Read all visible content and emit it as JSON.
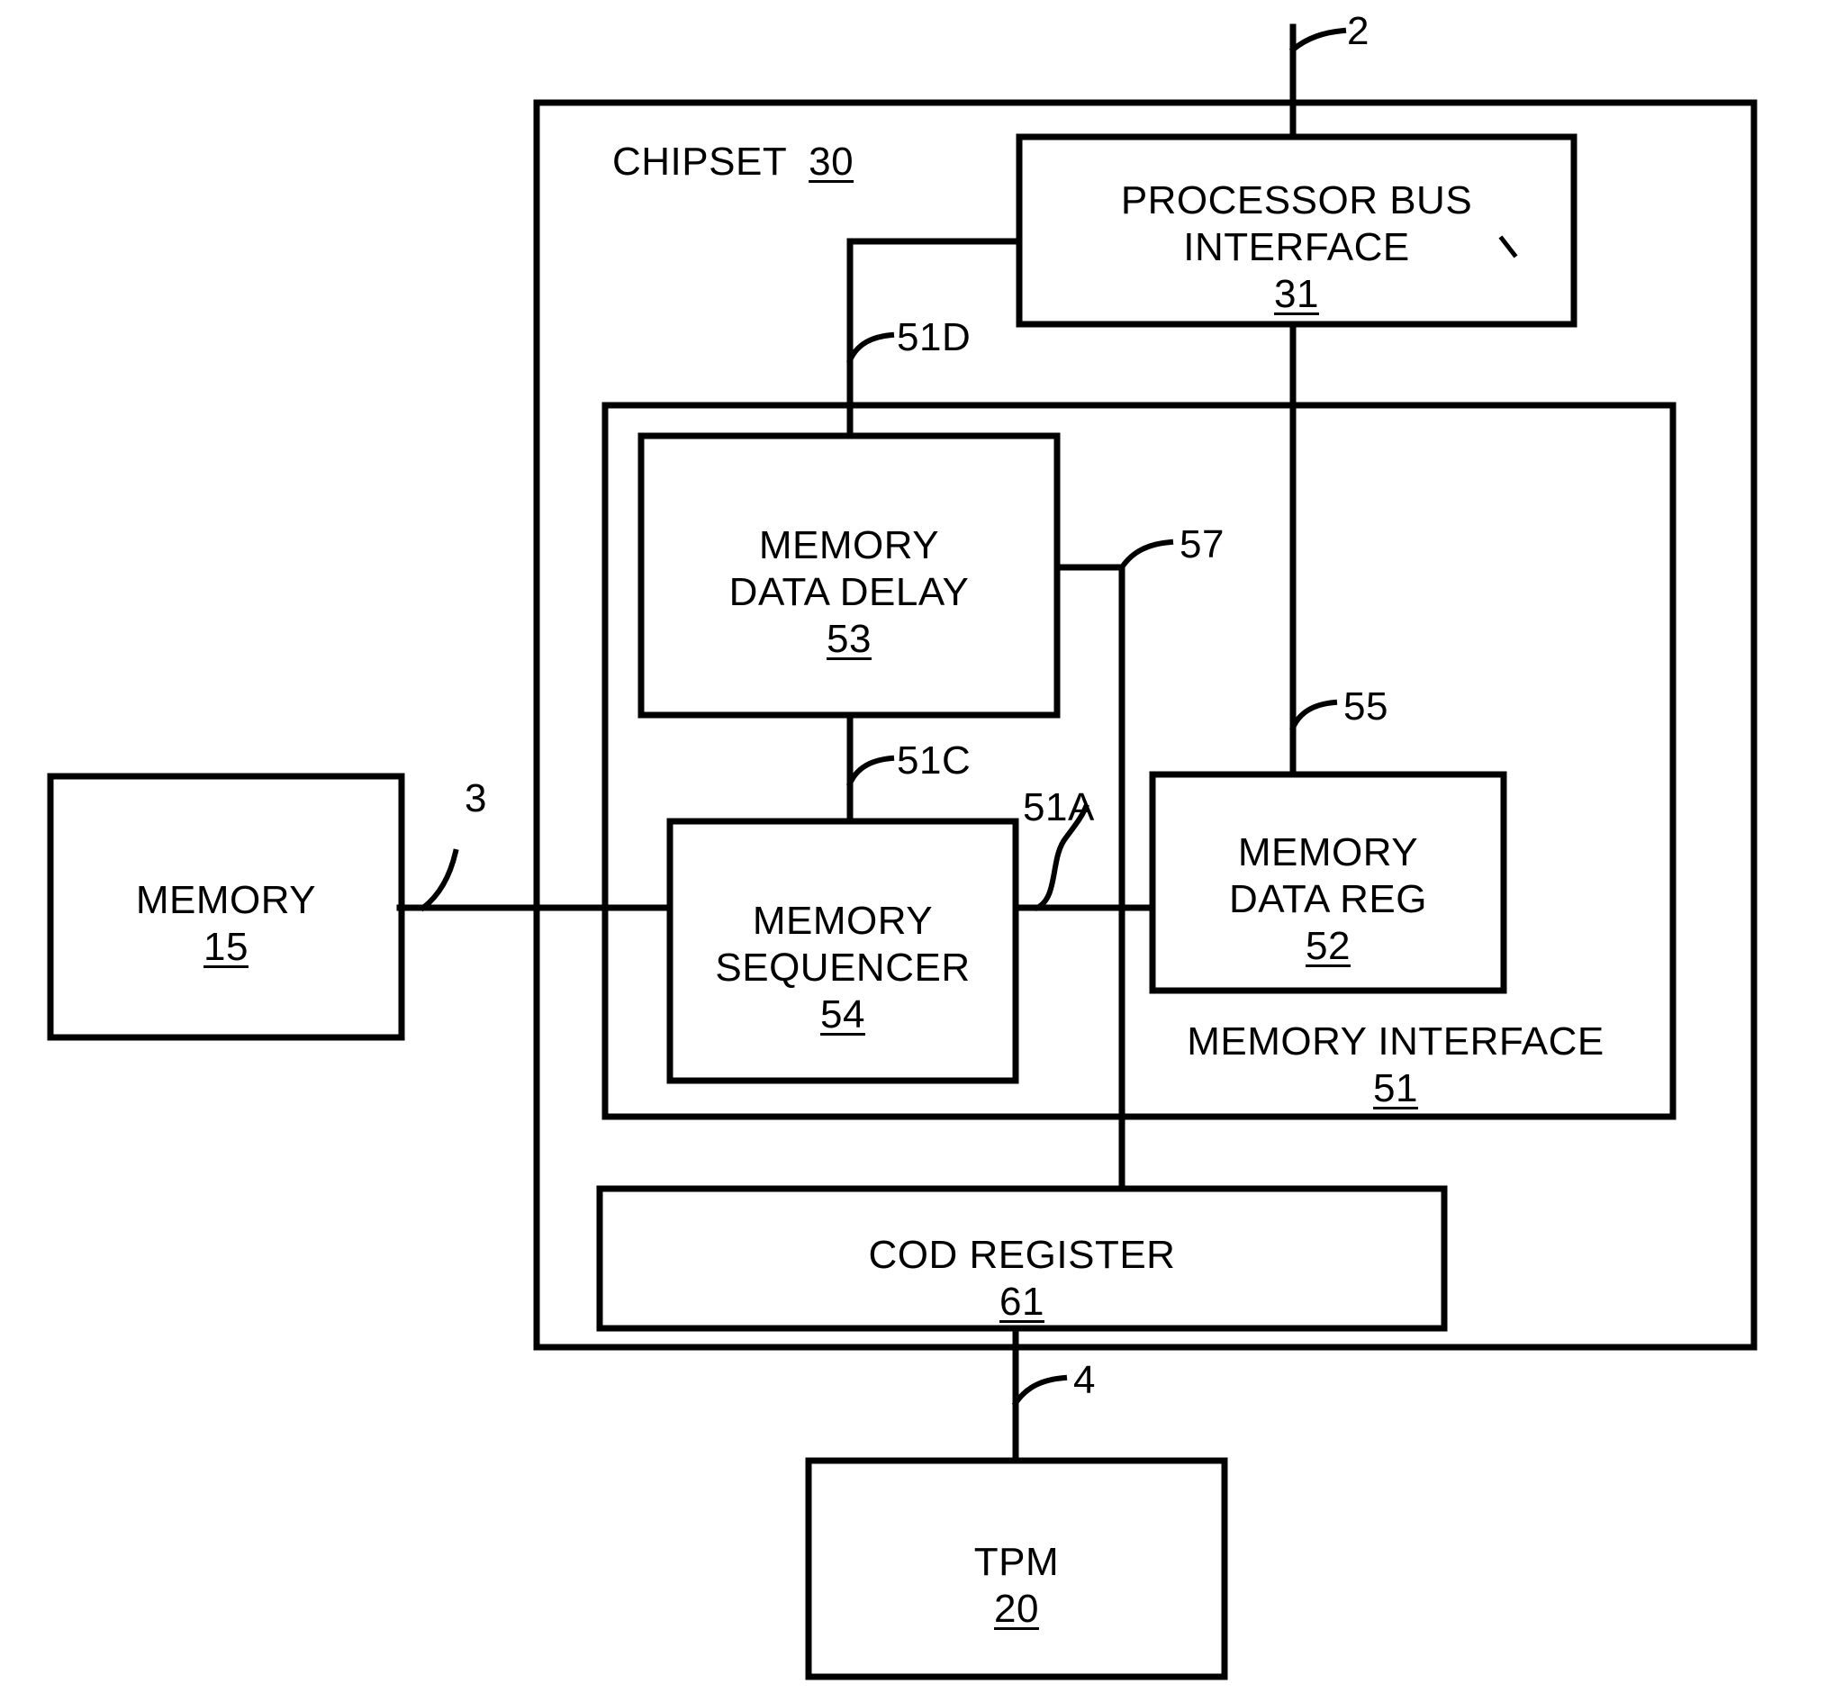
{
  "figure": {
    "type": "patent-block-diagram",
    "background_color": "#ffffff",
    "line_color": "#000000"
  },
  "blocks": {
    "chipset": {
      "label": "CHIPSET",
      "numeral": "30"
    },
    "processor_bus_interface": {
      "line1": "PROCESSOR BUS",
      "line2": "INTERFACE",
      "numeral": "31"
    },
    "memory_data_delay": {
      "line1": "MEMORY",
      "line2": "DATA DELAY",
      "numeral": "53"
    },
    "memory_sequencer": {
      "line1": "MEMORY",
      "line2": "SEQUENCER",
      "numeral": "54"
    },
    "memory_data_reg": {
      "line1": "MEMORY",
      "line2": "DATA REG",
      "numeral": "52"
    },
    "memory_interface": {
      "label": "MEMORY INTERFACE",
      "numeral": "51"
    },
    "cod_register": {
      "label": "COD REGISTER",
      "numeral": "61"
    },
    "memory": {
      "label": "MEMORY",
      "numeral": "15"
    },
    "tpm": {
      "label": "TPM",
      "numeral": "20"
    }
  },
  "reference_numerals": {
    "processor_bus": "2",
    "memory_bus": "3",
    "tpm_bus": "4",
    "sequencer_to_memreg": "51A",
    "delay_to_sequencer": "51C",
    "pbi_to_delay": "51D",
    "pbi_to_memreg": "55",
    "delay_branch": "57"
  }
}
